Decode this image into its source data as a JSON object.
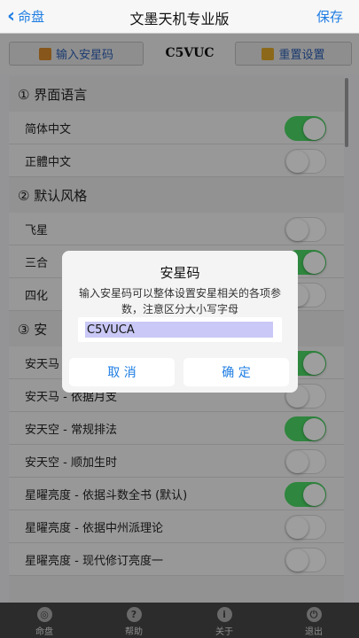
{
  "nav": {
    "back_label": "命盘",
    "title": "文墨天机专业版",
    "save_label": "保存"
  },
  "toolbar": {
    "input_button": "输入安星码",
    "code": "C5VUC",
    "reset_button": "重置设置"
  },
  "sections": [
    {
      "title": "① 界面语言",
      "rows": [
        {
          "label": "简体中文",
          "on": true
        },
        {
          "label": "正體中文",
          "on": false
        }
      ]
    },
    {
      "title": "② 默认风格",
      "rows": [
        {
          "label": "飞星",
          "on": false
        },
        {
          "label": "三合",
          "on": true
        },
        {
          "label": "四化",
          "on": false
        }
      ]
    },
    {
      "title": "③ 安",
      "rows": [
        {
          "label": "安天马",
          "on": true
        },
        {
          "label": "安天马 - 依据月支",
          "on": false
        },
        {
          "label": "安天空 - 常规排法",
          "on": true
        },
        {
          "label": "安天空 - 顺加生时",
          "on": false
        },
        {
          "label": "星曜亮度 - 依据斗数全书 (默认)",
          "on": true
        },
        {
          "label": "星曜亮度 - 依据中州派理论",
          "on": false
        },
        {
          "label": "星曜亮度 - 现代修订亮度一",
          "on": false
        }
      ]
    }
  ],
  "dialog": {
    "title": "安星码",
    "message": "输入安星码可以整体设置安星相关的各项参数，注意区分大小写字母",
    "input_value": "C5VUCA",
    "cancel_label": "取 消",
    "ok_label": "确 定"
  },
  "tabbar": [
    {
      "label": "命盘",
      "icon": "chart-icon",
      "glyph": "◎"
    },
    {
      "label": "帮助",
      "icon": "help-icon",
      "glyph": "?"
    },
    {
      "label": "关于",
      "icon": "info-icon",
      "glyph": "i"
    },
    {
      "label": "退出",
      "icon": "exit-icon",
      "glyph": "⏻"
    }
  ],
  "colors": {
    "accent": "#1e7de3",
    "toggle_on": "#4cd964"
  }
}
